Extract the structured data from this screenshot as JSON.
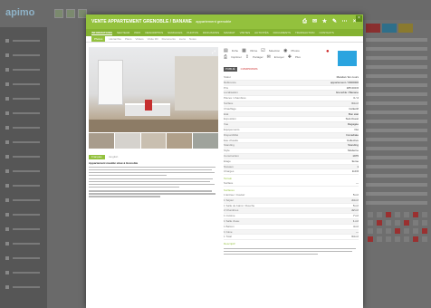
{
  "background_app": {
    "logo": "apimo"
  },
  "modal": {
    "title": "VENTE APPARTEMENT GRENOBLE / BANANE",
    "ref": "appartement grenoble",
    "header_icons": [
      "print-icon",
      "mail-icon",
      "star-icon",
      "edit-icon",
      "more-icon",
      "close-icon"
    ],
    "close_corner": "×",
    "main_tabs": [
      "INFORMATIONS",
      "SECTEUR",
      "PRIX",
      "DESCRIPTIFS",
      "SURFACES",
      "PHOTOS",
      "DIFFUSIONS",
      "MANDAT",
      "VISITES",
      "ACTIVITÉS",
      "DOCUMENTS",
      "TRANSACTION",
      "CONTACTS"
    ],
    "sub_tabs": [
      "Photos",
      "Hiérarchie",
      "Plans",
      "Vidéos",
      "Visite 3D",
      "Documents",
      "Liens",
      "Notes"
    ],
    "desc_tabs": [
      "Français",
      "English"
    ],
    "desc_title": "Appartement meublé situé à Grenoble"
  },
  "toolbar": {
    "row1": [
      "Fiche",
      "Vitrine",
      "Sélection",
      "Photos",
      "Affiche"
    ],
    "row2": [
      "Imprimer",
      "Partager",
      "Envoyer",
      "Plus"
    ]
  },
  "status": {
    "published": "PUBLIÉ",
    "warning": "COMPROMIS"
  },
  "properties": [
    {
      "k": "Statut",
      "v": "Mandat / En cours"
    },
    {
      "k": "Référence",
      "v": "appartement / 0000000"
    },
    {
      "k": "Prix",
      "v": "185 000 €"
    },
    {
      "k": "Localisation",
      "v": "Grenoble / Banane"
    },
    {
      "k": "Pièces / chambres",
      "v": "3 / 2"
    },
    {
      "k": "Surface",
      "v": "64 m²"
    },
    {
      "k": "Chauffage",
      "v": "Collectif"
    },
    {
      "k": "Etat",
      "v": "Bon état"
    },
    {
      "k": "Exposition",
      "v": "Sud-Ouest"
    },
    {
      "k": "Vue",
      "v": "Dégagée"
    },
    {
      "k": "Equipements",
      "v": "Oui"
    },
    {
      "k": "Disponibilité",
      "v": "Immédiate"
    },
    {
      "k": "Eau chaude",
      "v": "Collective"
    },
    {
      "k": "Standing",
      "v": "Standing"
    },
    {
      "k": "Style",
      "v": "Moderne"
    },
    {
      "k": "Construction",
      "v": "1975"
    },
    {
      "k": "Etage",
      "v": "3ème"
    },
    {
      "k": "Niveaux",
      "v": "1"
    },
    {
      "k": "Charges",
      "v": "110 €"
    }
  ],
  "section_terrain": "Terrain",
  "terrain_row": {
    "k": "Surface",
    "v": "—"
  },
  "section_surfaces": "Surfaces",
  "surfaces": [
    {
      "k": "1 Entrée / Couloir",
      "v": "5 m²"
    },
    {
      "k": "1 Séjour",
      "v": "24 m²"
    },
    {
      "k": "1 Salle de bains / Douche",
      "v": "5 m²"
    },
    {
      "k": "2 Chambres",
      "v": "22 m²"
    },
    {
      "k": "1 Cuisine",
      "v": "7 m²"
    },
    {
      "k": "1 Salle d'eau",
      "v": "1 m²"
    },
    {
      "k": "1 Balcon",
      "v": "4 m²"
    },
    {
      "k": "1 Cave",
      "v": "—"
    },
    {
      "k": "1 Total",
      "v": "64 m²"
    }
  ],
  "section_desc": "Descriptif"
}
